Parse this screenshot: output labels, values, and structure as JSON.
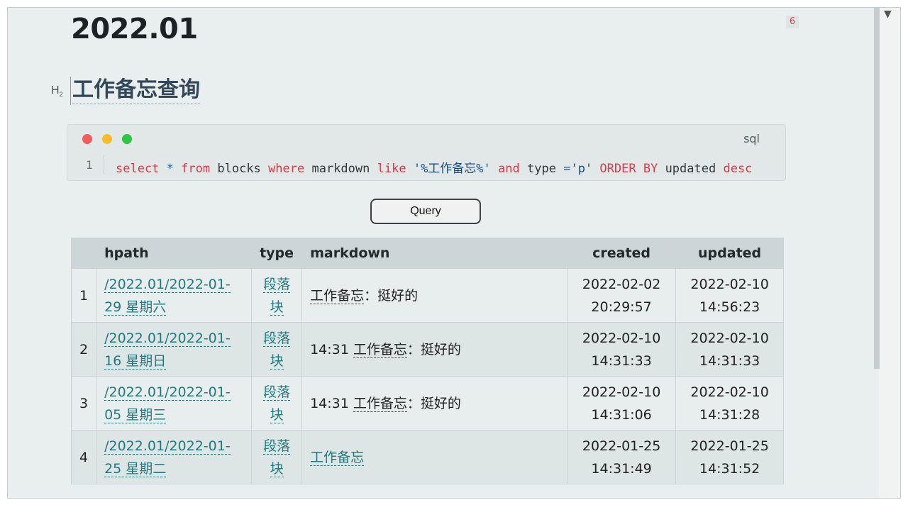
{
  "document": {
    "title": "2022.01",
    "count_badge": "6"
  },
  "heading": {
    "level_icon": "H",
    "level_sub": "2",
    "text": "工作备忘查询"
  },
  "code_block": {
    "language": "sql",
    "line_number": "1",
    "tokens": {
      "select": "select",
      "star": "*",
      "from": "from",
      "table": "blocks",
      "where": "where",
      "col_markdown": "markdown",
      "like": "like",
      "pattern": "'%工作备忘%'",
      "and": "and",
      "col_type": "type",
      "eq": "=",
      "type_value": "'p'",
      "order_by": "ORDER BY",
      "col_updated": "updated",
      "desc": "desc"
    },
    "window_dots": [
      "#f25d5a",
      "#f7bb2e",
      "#2dc743"
    ]
  },
  "query_button": {
    "label": "Query"
  },
  "table": {
    "headers": {
      "index": "",
      "hpath": "hpath",
      "type": "type",
      "markdown": "markdown",
      "created": "created",
      "updated": "updated"
    },
    "rows": [
      {
        "index": "1",
        "hpath_1": "/2022.01/2022-01-",
        "hpath_2": "29 星期六",
        "type_1": "段落",
        "type_2": "块",
        "md_prefix": "",
        "md_ref": "工作备忘",
        "md_suffix": "：挺好的",
        "created_date": "2022-02-02",
        "created_time": "20:29:57",
        "updated_date": "2022-02-10",
        "updated_time": "14:56:23"
      },
      {
        "index": "2",
        "hpath_1": "/2022.01/2022-01-",
        "hpath_2": "16 星期日",
        "type_1": "段落",
        "type_2": "块",
        "md_prefix": "14:31 ",
        "md_ref": "工作备忘",
        "md_suffix": "：挺好的",
        "created_date": "2022-02-10",
        "created_time": "14:31:33",
        "updated_date": "2022-02-10",
        "updated_time": "14:31:33"
      },
      {
        "index": "3",
        "hpath_1": "/2022.01/2022-01-",
        "hpath_2": "05 星期三",
        "type_1": "段落",
        "type_2": "块",
        "md_prefix": "14:31 ",
        "md_ref": "工作备忘",
        "md_suffix": "：挺好的",
        "created_date": "2022-02-10",
        "created_time": "14:31:06",
        "updated_date": "2022-02-10",
        "updated_time": "14:31:28"
      },
      {
        "index": "4",
        "hpath_1": "/2022.01/2022-01-",
        "hpath_2": "25 星期二",
        "type_1": "段落",
        "type_2": "块",
        "md_link": "工作备忘",
        "created_date": "2022-01-25",
        "created_time": "14:31:49",
        "updated_date": "2022-01-25",
        "updated_time": "14:31:52"
      }
    ]
  },
  "colors": {
    "keyword": "#d73a49",
    "link": "#227a80",
    "background": "#e9eeee"
  }
}
